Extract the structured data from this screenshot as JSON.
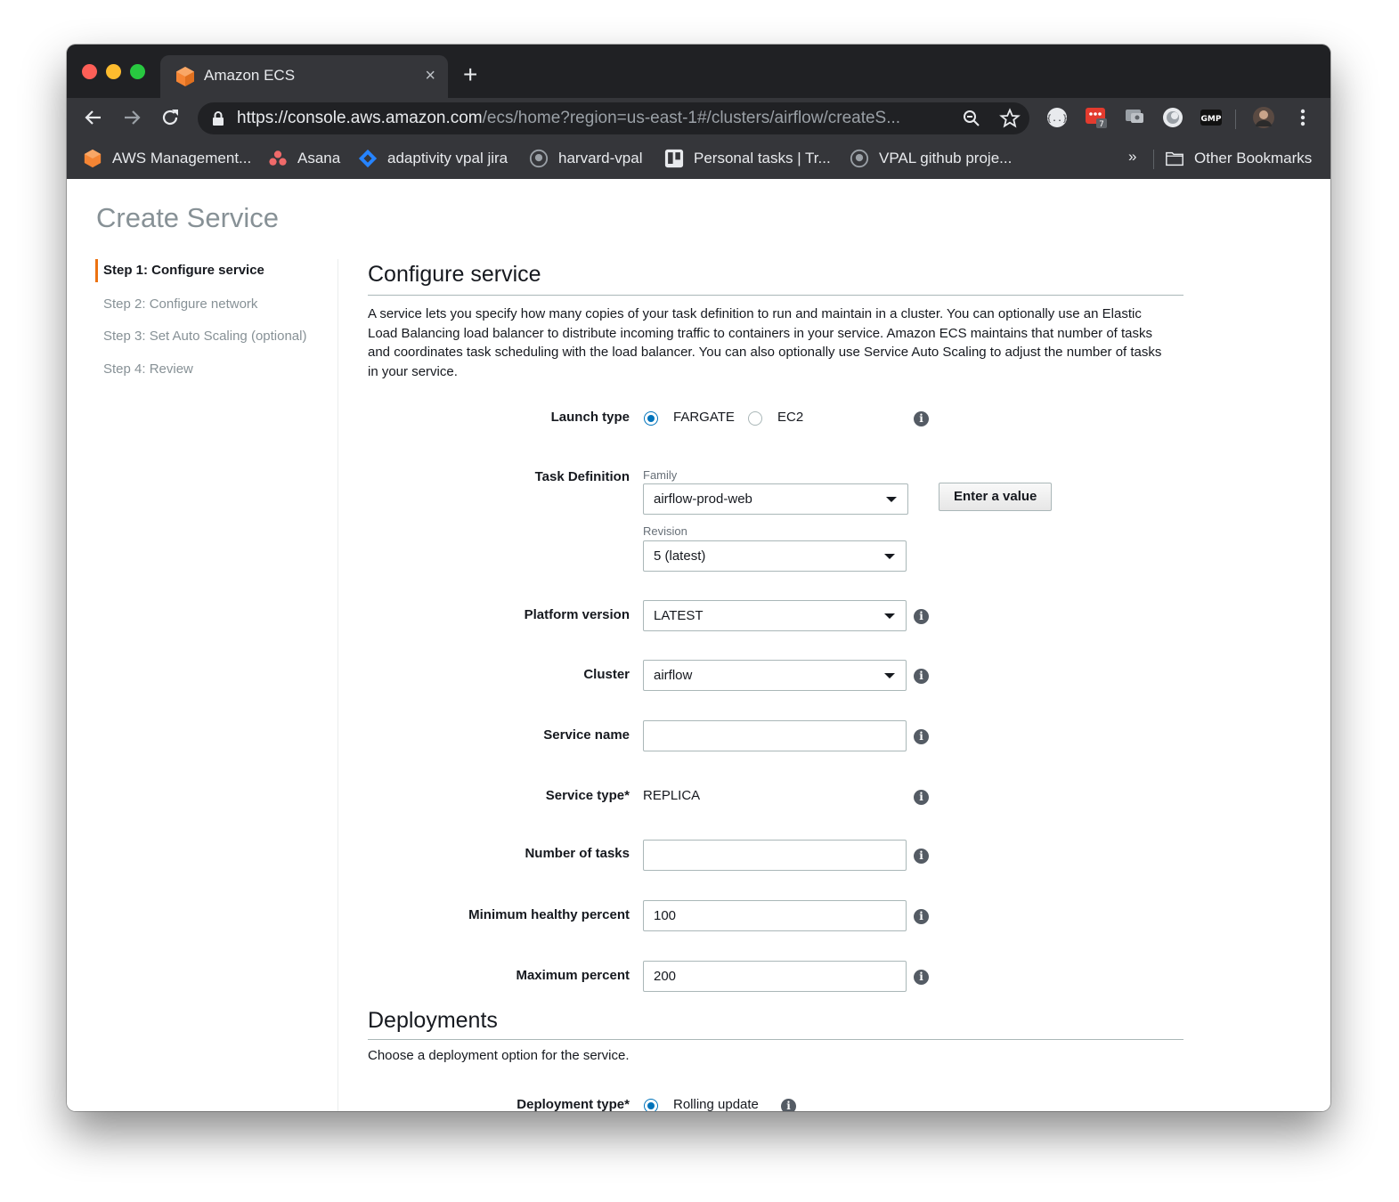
{
  "browser": {
    "tab_title": "Amazon ECS",
    "tab_close": "×",
    "new_tab": "+",
    "url_host": "https://console.aws.amazon.com",
    "url_path": "/ecs/home?region=us-east-1#/clusters/airflow/createS...",
    "extension_badge": "7",
    "bookmarks": [
      {
        "label": "AWS Management...",
        "icon": "aws-cube-icon"
      },
      {
        "label": "Asana",
        "icon": "asana-icon"
      },
      {
        "label": "adaptivity vpal jira",
        "icon": "jira-icon"
      },
      {
        "label": "harvard-vpal",
        "icon": "github-icon"
      },
      {
        "label": "Personal tasks | Tr...",
        "icon": "trello-icon"
      },
      {
        "label": "VPAL github proje...",
        "icon": "github-icon"
      }
    ],
    "bookmarks_more": "»",
    "other_bookmarks": "Other Bookmarks"
  },
  "page": {
    "title": "Create Service",
    "steps": [
      {
        "label": "Step 1: Configure service",
        "active": true
      },
      {
        "label": "Step 2: Configure network",
        "active": false
      },
      {
        "label": "Step 3: Set Auto Scaling (optional)",
        "active": false
      },
      {
        "label": "Step 4: Review",
        "active": false
      }
    ]
  },
  "configure": {
    "heading": "Configure service",
    "description": "A service lets you specify how many copies of your task definition to run and maintain in a cluster. You can optionally use an Elastic Load Balancing load balancer to distribute incoming traffic to containers in your service. Amazon ECS maintains that number of tasks and coordinates task scheduling with the load balancer. You can also optionally use Service Auto Scaling to adjust the number of tasks in your service.",
    "launch_type": {
      "label": "Launch type",
      "options": [
        "FARGATE",
        "EC2"
      ],
      "selected": "FARGATE"
    },
    "task_definition": {
      "label": "Task Definition",
      "family_label": "Family",
      "family_value": "airflow-prod-web",
      "enter_value_button": "Enter a value",
      "revision_label": "Revision",
      "revision_value": "5 (latest)"
    },
    "platform_version": {
      "label": "Platform version",
      "value": "LATEST"
    },
    "cluster": {
      "label": "Cluster",
      "value": "airflow"
    },
    "service_name": {
      "label": "Service name",
      "value": ""
    },
    "service_type": {
      "label": "Service type*",
      "value": "REPLICA"
    },
    "number_of_tasks": {
      "label": "Number of tasks",
      "value": ""
    },
    "min_healthy_percent": {
      "label": "Minimum healthy percent",
      "value": "100"
    },
    "max_percent": {
      "label": "Maximum percent",
      "value": "200"
    },
    "info_glyph": "i"
  },
  "deployments": {
    "heading": "Deployments",
    "description": "Choose a deployment option for the service.",
    "deployment_type": {
      "label": "Deployment type*",
      "selected": "Rolling update"
    }
  },
  "colors": {
    "accent_orange": "#ec7211",
    "radio_blue": "#0073bb",
    "chrome_dark": "#35363a"
  }
}
